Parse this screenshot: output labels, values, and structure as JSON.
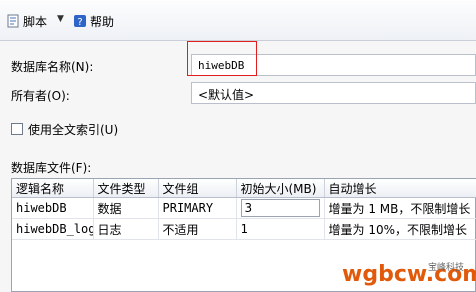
{
  "toolbar": {
    "script_label": "脚本",
    "help_label": "帮助"
  },
  "form": {
    "db_name_label": "数据库名称(N):",
    "db_name_value": "hiwebDB",
    "owner_label": "所有者(O):",
    "owner_value": "<默认值>",
    "fulltext_label": "使用全文索引(U)",
    "fulltext_checked": false,
    "files_label": "数据库文件(F):"
  },
  "files_table": {
    "columns": [
      "逻辑名称",
      "文件类型",
      "文件组",
      "初始大小(MB)",
      "自动增长"
    ],
    "rows": [
      [
        "hiwebDB",
        "数据",
        "PRIMARY",
        "3",
        "增量为 1 MB，不限制增长"
      ],
      [
        "hiwebDB_log",
        "日志",
        "不适用",
        "1",
        "增量为 10%，不限制增长"
      ]
    ]
  },
  "watermark": {
    "main": "wgbcw.com",
    "small": "宝峰科技"
  },
  "colors": {
    "highlight_box": "#e11d1d",
    "watermark": "#e15a0b"
  }
}
